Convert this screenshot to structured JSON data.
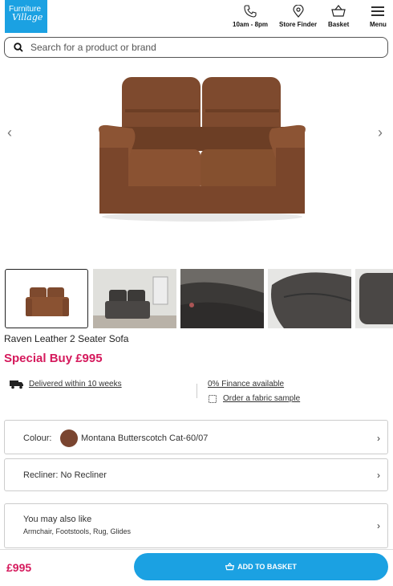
{
  "header": {
    "logo_line1": "Furniture",
    "logo_line2": "Village",
    "hours": "10am - 8pm",
    "store_finder": "Store Finder",
    "basket": "Basket",
    "menu": "Menu"
  },
  "search": {
    "placeholder": "Search for a product or brand"
  },
  "product": {
    "title": "Raven Leather 2 Seater Sofa",
    "price_text": "Special Buy £995"
  },
  "delivery": {
    "label": "Delivered within 10 weeks",
    "icon": "truck-icon"
  },
  "finance": {
    "label": "0% Finance available"
  },
  "sample": {
    "label": "Order a fabric sample",
    "icon": "swatch-icon"
  },
  "options": {
    "colour_label": "Colour:",
    "colour_value": "Montana Butterscotch Cat-60/07",
    "colour_hex": "#7a4530",
    "recliner": "Recliner: No Recliner",
    "also_title": "You may also like",
    "also_items": "Armchair, Footstools, Rug, Glides"
  },
  "bottom_bar": {
    "price": "£995",
    "add_label": "ADD TO BASKET"
  },
  "colors": {
    "brand_blue": "#1ba1e2",
    "price_pink": "#d5195c"
  }
}
